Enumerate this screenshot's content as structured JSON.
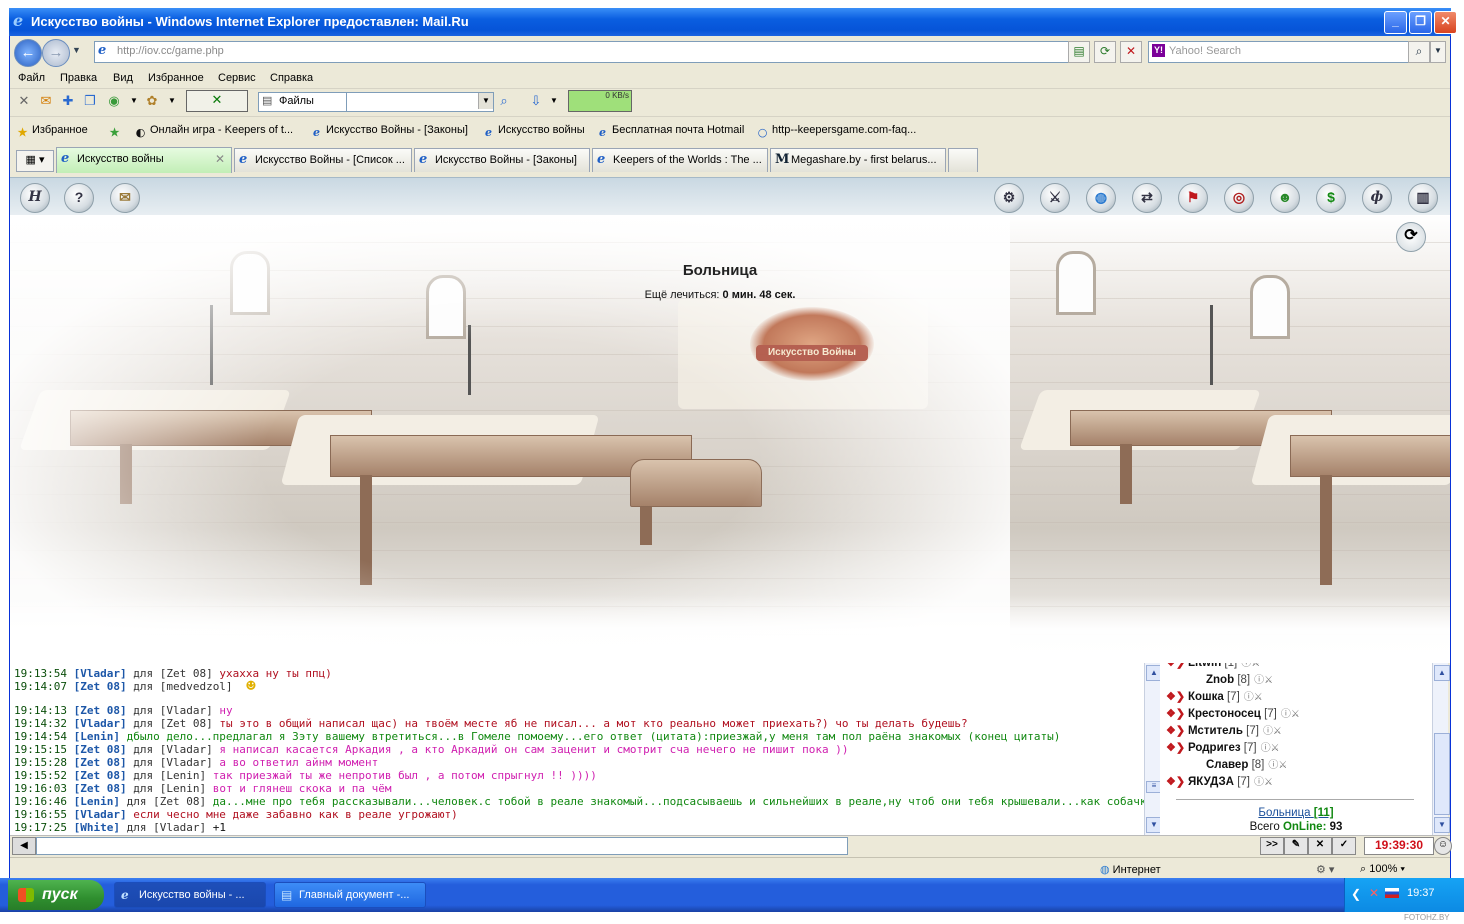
{
  "window": {
    "title": "Искусство войны - Windows Internet Explorer предоставлен: Mail.Ru",
    "address": "http://iov.cc/game.php",
    "search_placeholder": "Yahoo! Search"
  },
  "menu": [
    "Файл",
    "Правка",
    "Вид",
    "Избранное",
    "Сервис",
    "Справка"
  ],
  "toolbar": {
    "files_label": "Файлы",
    "speed_label": "0 KB/s"
  },
  "favorites": {
    "label": "Избранное",
    "items": [
      "Онлайн игра - Keepers of t...",
      "Искусство Войны - [Законы]",
      "Искусство войны",
      "Бесплатная почта Hotmail",
      "http--keepersgame.com-faq..."
    ]
  },
  "tabs": [
    "Искусство войны",
    "Искусство Войны - [Список ...",
    "Искусство Войны - [Законы]",
    "Keepers of the Worlds : The ...",
    "Megashare.by - first belarus..."
  ],
  "game": {
    "location_title": "Больница",
    "heal_label": "Ещё лечиться:",
    "heal_time": "0 мин. 48 сек.",
    "emblem_text": "Искусство Войны",
    "top_buttons_left": [
      "Н",
      "?",
      "свиток"
    ],
    "top_buttons_right": [
      "шестерни",
      "оружие",
      "глобус",
      "обмен",
      "флаг",
      "глаз",
      "люди",
      "деньги",
      "ф",
      "книга"
    ]
  },
  "chat": [
    {
      "time": "19:13:54",
      "from": "[Vladar]",
      "for": "для [Zet 08]",
      "text": "ухахха ну ты ппц)",
      "color": "#b01020"
    },
    {
      "time": "19:14:07",
      "from": "[Zet 08]",
      "for": "для [medvedzol]",
      "text": "",
      "color": "#b01020"
    },
    {
      "time": "19:14:13",
      "from": "[Zet 08]",
      "for": "для [Vladar]",
      "text": "ну",
      "color": "#d020b0"
    },
    {
      "time": "19:14:32",
      "from": "[Vladar]",
      "for": "для [Zet 08]",
      "text": "ты это в общий написал щас) на твоём месте яб не писал... а мот кто реально может приехать?) чо ты делать будешь?",
      "color": "#b01020"
    },
    {
      "time": "19:14:54",
      "from": "[Lenin]",
      "for": "",
      "text": "дбыло дело...предлагал я Зэту вашему втретиться...в Гомеле помоему...его ответ (цитата):приезжай,у меня там пол раёна знакомых (конец цитаты)",
      "color": "#118811"
    },
    {
      "time": "19:15:15",
      "from": "[Zet 08]",
      "for": "для [Vladar]",
      "text": "я написал касается Аркадия , а кто Аркадий он сам заценит и смотрит сча нечего не пишит пока ))",
      "color": "#d020b0"
    },
    {
      "time": "19:15:28",
      "from": "[Zet 08]",
      "for": "для [Vladar]",
      "text": "а во ответил айнм момент",
      "color": "#d020b0"
    },
    {
      "time": "19:15:52",
      "from": "[Zet 08]",
      "for": "для [Lenin]",
      "text": "так приезжай ты же непротив был , а потом спрыгнул !! ))))",
      "color": "#d020b0"
    },
    {
      "time": "19:16:03",
      "from": "[Zet 08]",
      "for": "для [Lenin]",
      "text": "вот и глянеш скока и па чём",
      "color": "#d020b0"
    },
    {
      "time": "19:16:46",
      "from": "[Lenin]",
      "for": "для [Zet 08]",
      "text": "да...мне про тебя рассказывали...человек.с тобой в реале знакомый...подсасываешь и сильнейших в реале,ну чтоб они тебя крышевали...как собачка...",
      "color": "#118811"
    },
    {
      "time": "19:16:55",
      "from": "[Vladar]",
      "for": "",
      "text": "если чесно мне даже забавно как в реале угрожают)",
      "color": "#b01020"
    },
    {
      "time": "19:17:25",
      "from": "[White]",
      "for": "для [Vladar]",
      "text": "+1",
      "color": "#111111"
    }
  ],
  "users": [
    {
      "name": "Litwin",
      "level": "[1]"
    },
    {
      "name": "Znob",
      "level": "[8]"
    },
    {
      "name": "Кошка",
      "level": "[7]"
    },
    {
      "name": "Крестоносец",
      "level": "[7]"
    },
    {
      "name": "Мститель",
      "level": "[7]"
    },
    {
      "name": "Родригез",
      "level": "[7]"
    },
    {
      "name": "Славер",
      "level": "[8]"
    },
    {
      "name": "ЯКУДЗА",
      "level": "[7]"
    }
  ],
  "location_summary": {
    "name": "Больница",
    "count": "[11]",
    "total_label": "Всего",
    "online_label": "OnLine:",
    "online_count": "93"
  },
  "clock": "19:39:30",
  "statusbar": {
    "zone": "Интернет",
    "zoom": "100%"
  },
  "taskbar": {
    "start": "пуск",
    "tasks": [
      "Искусство войны - ...",
      "Главный документ -..."
    ],
    "time": "19:37"
  },
  "watermark": "FOTOHZ.BY"
}
